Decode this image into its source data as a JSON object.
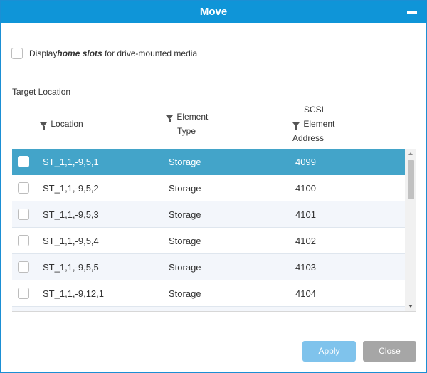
{
  "dialog": {
    "title": "Move"
  },
  "option": {
    "prefix": "Display",
    "emphasis": "home slots",
    "suffix": " for drive-mounted media"
  },
  "section_label": "Target Location",
  "columns": {
    "location": "Location",
    "element_type": [
      "Element",
      "Type"
    ],
    "address": [
      "SCSI",
      "Element",
      "Address"
    ]
  },
  "rows": [
    {
      "location": "ST_1,1,-9,5,1",
      "type": "Storage",
      "address": "4099"
    },
    {
      "location": "ST_1,1,-9,5,2",
      "type": "Storage",
      "address": "4100"
    },
    {
      "location": "ST_1,1,-9,5,3",
      "type": "Storage",
      "address": "4101"
    },
    {
      "location": "ST_1,1,-9,5,4",
      "type": "Storage",
      "address": "4102"
    },
    {
      "location": "ST_1,1,-9,5,5",
      "type": "Storage",
      "address": "4103"
    },
    {
      "location": "ST_1,1,-9,12,1",
      "type": "Storage",
      "address": "4104"
    }
  ],
  "selected_row": 0,
  "buttons": {
    "apply": "Apply",
    "close": "Close"
  },
  "colors": {
    "title_bar": "#0f95d8",
    "selected_row": "#43a4c9",
    "apply": "#7fc3ec",
    "close": "#a6a6a6"
  },
  "icons": {
    "minimize": "minimize-icon",
    "filter": "filter-icon"
  }
}
